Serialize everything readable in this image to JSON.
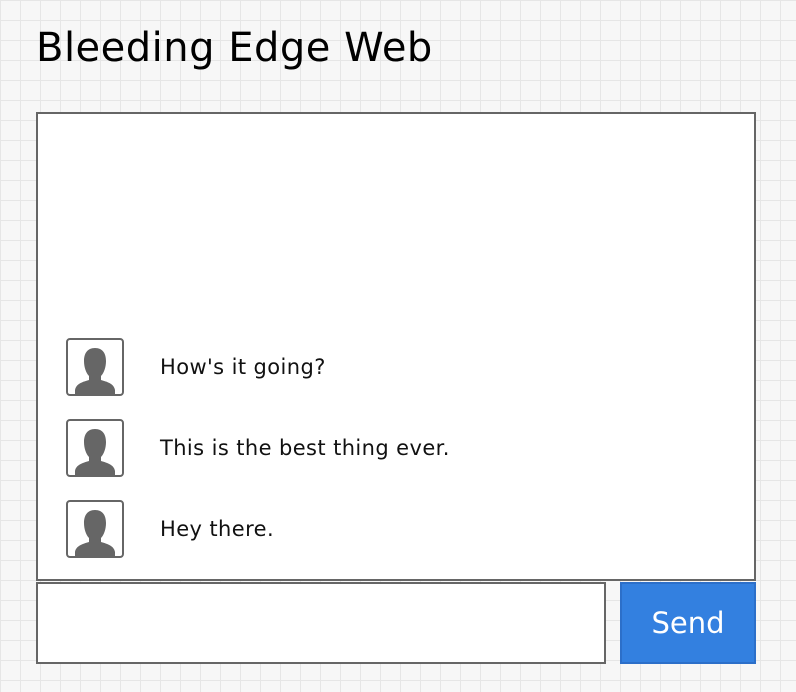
{
  "page": {
    "title": "Bleeding Edge Web"
  },
  "chat": {
    "messages": [
      {
        "avatar_icon": "user-avatar-icon",
        "text": "How's it going?"
      },
      {
        "avatar_icon": "user-avatar-icon",
        "text": "This is the best thing ever."
      },
      {
        "avatar_icon": "user-avatar-icon",
        "text": "Hey there."
      }
    ]
  },
  "composer": {
    "input_value": "",
    "input_placeholder": "",
    "send_label": "Send"
  },
  "colors": {
    "accent": "#3380e0",
    "border": "#666666",
    "avatar_fill": "#666666"
  }
}
